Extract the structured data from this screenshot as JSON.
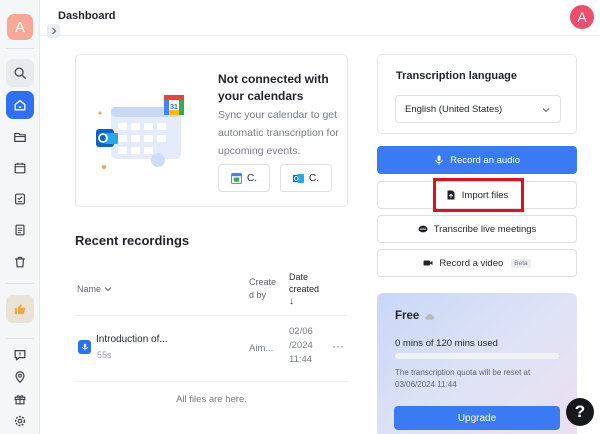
{
  "app": {
    "title": "Dashboard",
    "user_initial": "A"
  },
  "sidebar": {
    "workspace_initial": "A",
    "icons": [
      "search-icon",
      "home-icon",
      "folder-icon",
      "calendar-icon",
      "task-list-icon",
      "document-icon",
      "trash-icon",
      "thumbs-up-icon",
      "feedback-icon",
      "location-pin-icon",
      "gift-icon",
      "settings-icon"
    ],
    "active_item": "home"
  },
  "calendar_card": {
    "title": "Not connected with your calendars",
    "description": "Sync your calendar to get automatic transcription for upcoming events.",
    "google_button": "C.",
    "outlook_button": "C."
  },
  "recordings": {
    "heading": "Recent recordings",
    "columns": {
      "name": "Name",
      "created_by": "Create d by",
      "date_created": "Date created",
      "sort_arrow": "↓"
    },
    "rows": [
      {
        "title": "Introduction of...",
        "duration": "55s",
        "created_by": "Aim...",
        "date": "02/06 /2024 11:44",
        "more": "···"
      }
    ],
    "footer": "All files are here."
  },
  "language_card": {
    "title": "Transcription language",
    "selected": "English (United States)"
  },
  "actions": {
    "record_audio": "Record an audio",
    "import_files": "Import files",
    "transcribe_live": "Transcribe live meetings",
    "record_video": "Record a video",
    "beta": "Beta"
  },
  "plan": {
    "name": "Free",
    "usage": "0 mins of 120 mins used",
    "usage_fraction": 0.0,
    "note": "The transcription quota will be reset at 03/06/2024 11:44",
    "upgrade": "Upgrade"
  },
  "help": {
    "label": "?"
  },
  "colors": {
    "primary": "#3a7af2",
    "highlight_box": "#e0101e",
    "avatar": "#ef4d6c"
  }
}
